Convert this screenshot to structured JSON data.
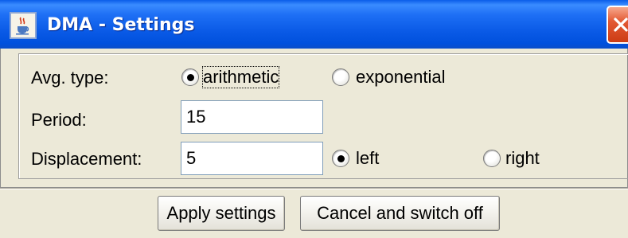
{
  "window": {
    "title": "DMA - Settings",
    "icon": "java-cup-icon",
    "close_icon": "close-icon"
  },
  "form": {
    "avg_type": {
      "label": "Avg. type:",
      "options": [
        {
          "label": "arithmetic",
          "selected": true
        },
        {
          "label": "exponential",
          "selected": false
        }
      ]
    },
    "period": {
      "label": "Period:",
      "value": "15"
    },
    "displacement": {
      "label": "Displacement:",
      "value": "5",
      "options": [
        {
          "label": "left",
          "selected": true
        },
        {
          "label": "right",
          "selected": false
        }
      ]
    }
  },
  "buttons": {
    "apply": "Apply settings",
    "cancel": "Cancel and switch off"
  },
  "colors": {
    "titlebar": "#0a5ae6",
    "window_bg": "#ece9d8",
    "close_button": "#e35a34"
  }
}
